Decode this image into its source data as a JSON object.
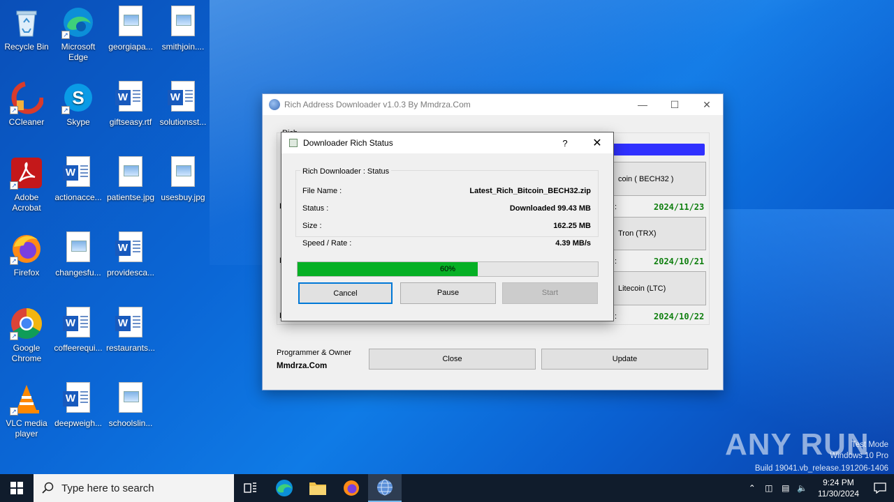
{
  "desktop": {
    "icons": [
      {
        "label": "Recycle Bin",
        "icon": "recycle-bin-icon"
      },
      {
        "label": "Microsoft Edge",
        "icon": "edge-icon"
      },
      {
        "label": "georgiapa...",
        "icon": "image-file-icon"
      },
      {
        "label": "smithjoin....",
        "icon": "image-file-icon"
      },
      {
        "label": "CCleaner",
        "icon": "ccleaner-icon"
      },
      {
        "label": "Skype",
        "icon": "skype-icon"
      },
      {
        "label": "giftseasy.rtf",
        "icon": "word-document-icon"
      },
      {
        "label": "solutionsst...",
        "icon": "word-document-icon"
      },
      {
        "label": "Adobe Acrobat",
        "icon": "acrobat-icon"
      },
      {
        "label": "actionacce...",
        "icon": "word-document-icon"
      },
      {
        "label": "patientse.jpg",
        "icon": "image-file-icon"
      },
      {
        "label": "usesbuy.jpg",
        "icon": "image-file-icon"
      },
      {
        "label": "Firefox",
        "icon": "firefox-icon"
      },
      {
        "label": "changesfu...",
        "icon": "image-file-icon"
      },
      {
        "label": "providesca...",
        "icon": "word-document-icon"
      },
      {
        "label": "Google Chrome",
        "icon": "chrome-icon"
      },
      {
        "label": "coffeerequi...",
        "icon": "word-document-icon"
      },
      {
        "label": "restaurants...",
        "icon": "word-document-icon"
      },
      {
        "label": "VLC media player",
        "icon": "vlc-icon"
      },
      {
        "label": "deepweigh...",
        "icon": "word-document-icon"
      },
      {
        "label": "schoolslin...",
        "icon": "image-file-icon"
      }
    ]
  },
  "main_window": {
    "title": "Rich Address Downloader v1.0.3 By Mmdrza.Com",
    "group_label_partial": "Rich Details",
    "rows": [
      {
        "label_partial": "coin ( BECH32 )",
        "date": "2024/11/23"
      },
      {
        "label_partial": "Tron (TRX)",
        "date": "2024/10/21"
      },
      {
        "label_partial": "Litecoin (LTC)",
        "date": "2024/10/22"
      }
    ],
    "owner_caption": "Programmer & Owner",
    "owner_name": "Mmdrza.Com",
    "close_label": "Close",
    "update_label": "Update"
  },
  "dialog": {
    "title": "Downloader Rich Status",
    "help_label": "?",
    "group_label": "Rich Downloader : Status",
    "fields": [
      {
        "label": "File Name :",
        "value": "Latest_Rich_Bitcoin_BECH32.zip"
      },
      {
        "label": "Status :",
        "value": "Downloaded 99.43 MB"
      },
      {
        "label": "Size :",
        "value": "162.25 MB"
      },
      {
        "label": "Speed / Rate :",
        "value": "4.39 MB/s"
      }
    ],
    "progress": {
      "value": 0.6,
      "label": "60%",
      "color": "#06b025"
    },
    "buttons": {
      "cancel": "Cancel",
      "pause": "Pause",
      "start": "Start"
    }
  },
  "watermark": {
    "brand": "ANY RUN",
    "line1": "Test Mode",
    "line2": "Windows 10 Pro",
    "line3": "Build 19041.vb_release.191206-1406"
  },
  "taskbar": {
    "search_placeholder": "Type here to search",
    "time": "9:24 PM",
    "date": "11/30/2024"
  }
}
